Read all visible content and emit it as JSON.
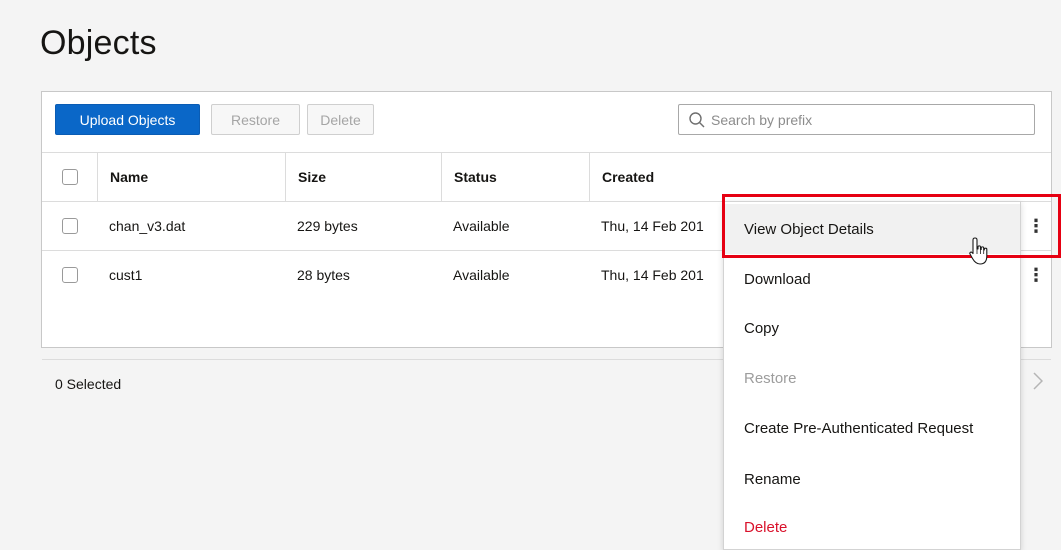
{
  "page": {
    "title": "Objects"
  },
  "toolbar": {
    "upload_label": "Upload Objects",
    "restore_label": "Restore",
    "delete_label": "Delete"
  },
  "search": {
    "placeholder": "Search by prefix",
    "value": ""
  },
  "table": {
    "columns": [
      "Name",
      "Size",
      "Status",
      "Created"
    ],
    "rows": [
      {
        "name": "chan_v3.dat",
        "size": "229 bytes",
        "status": "Available",
        "created": "Thu, 14 Feb 201"
      },
      {
        "name": "cust1",
        "size": "28 bytes",
        "status": "Available",
        "created": "Thu, 14 Feb 201"
      }
    ],
    "selected_text": "0 Selected"
  },
  "menu": {
    "items": [
      {
        "label": "View Object Details",
        "state": "hover"
      },
      {
        "label": "Download",
        "state": "normal"
      },
      {
        "label": "Copy",
        "state": "normal"
      },
      {
        "label": "Restore",
        "state": "disabled"
      },
      {
        "label": "Create Pre-Authenticated Request",
        "state": "normal"
      },
      {
        "label": "Rename",
        "state": "normal"
      },
      {
        "label": "Delete",
        "state": "danger"
      }
    ]
  },
  "colors": {
    "primary": "#0a67c8",
    "danger": "#d9112b",
    "highlight": "#e60012"
  },
  "icons": {
    "search": "search-icon",
    "kebab": "kebab-menu-icon",
    "next": "chevron-right-icon",
    "cursor": "hand-pointer-icon"
  }
}
